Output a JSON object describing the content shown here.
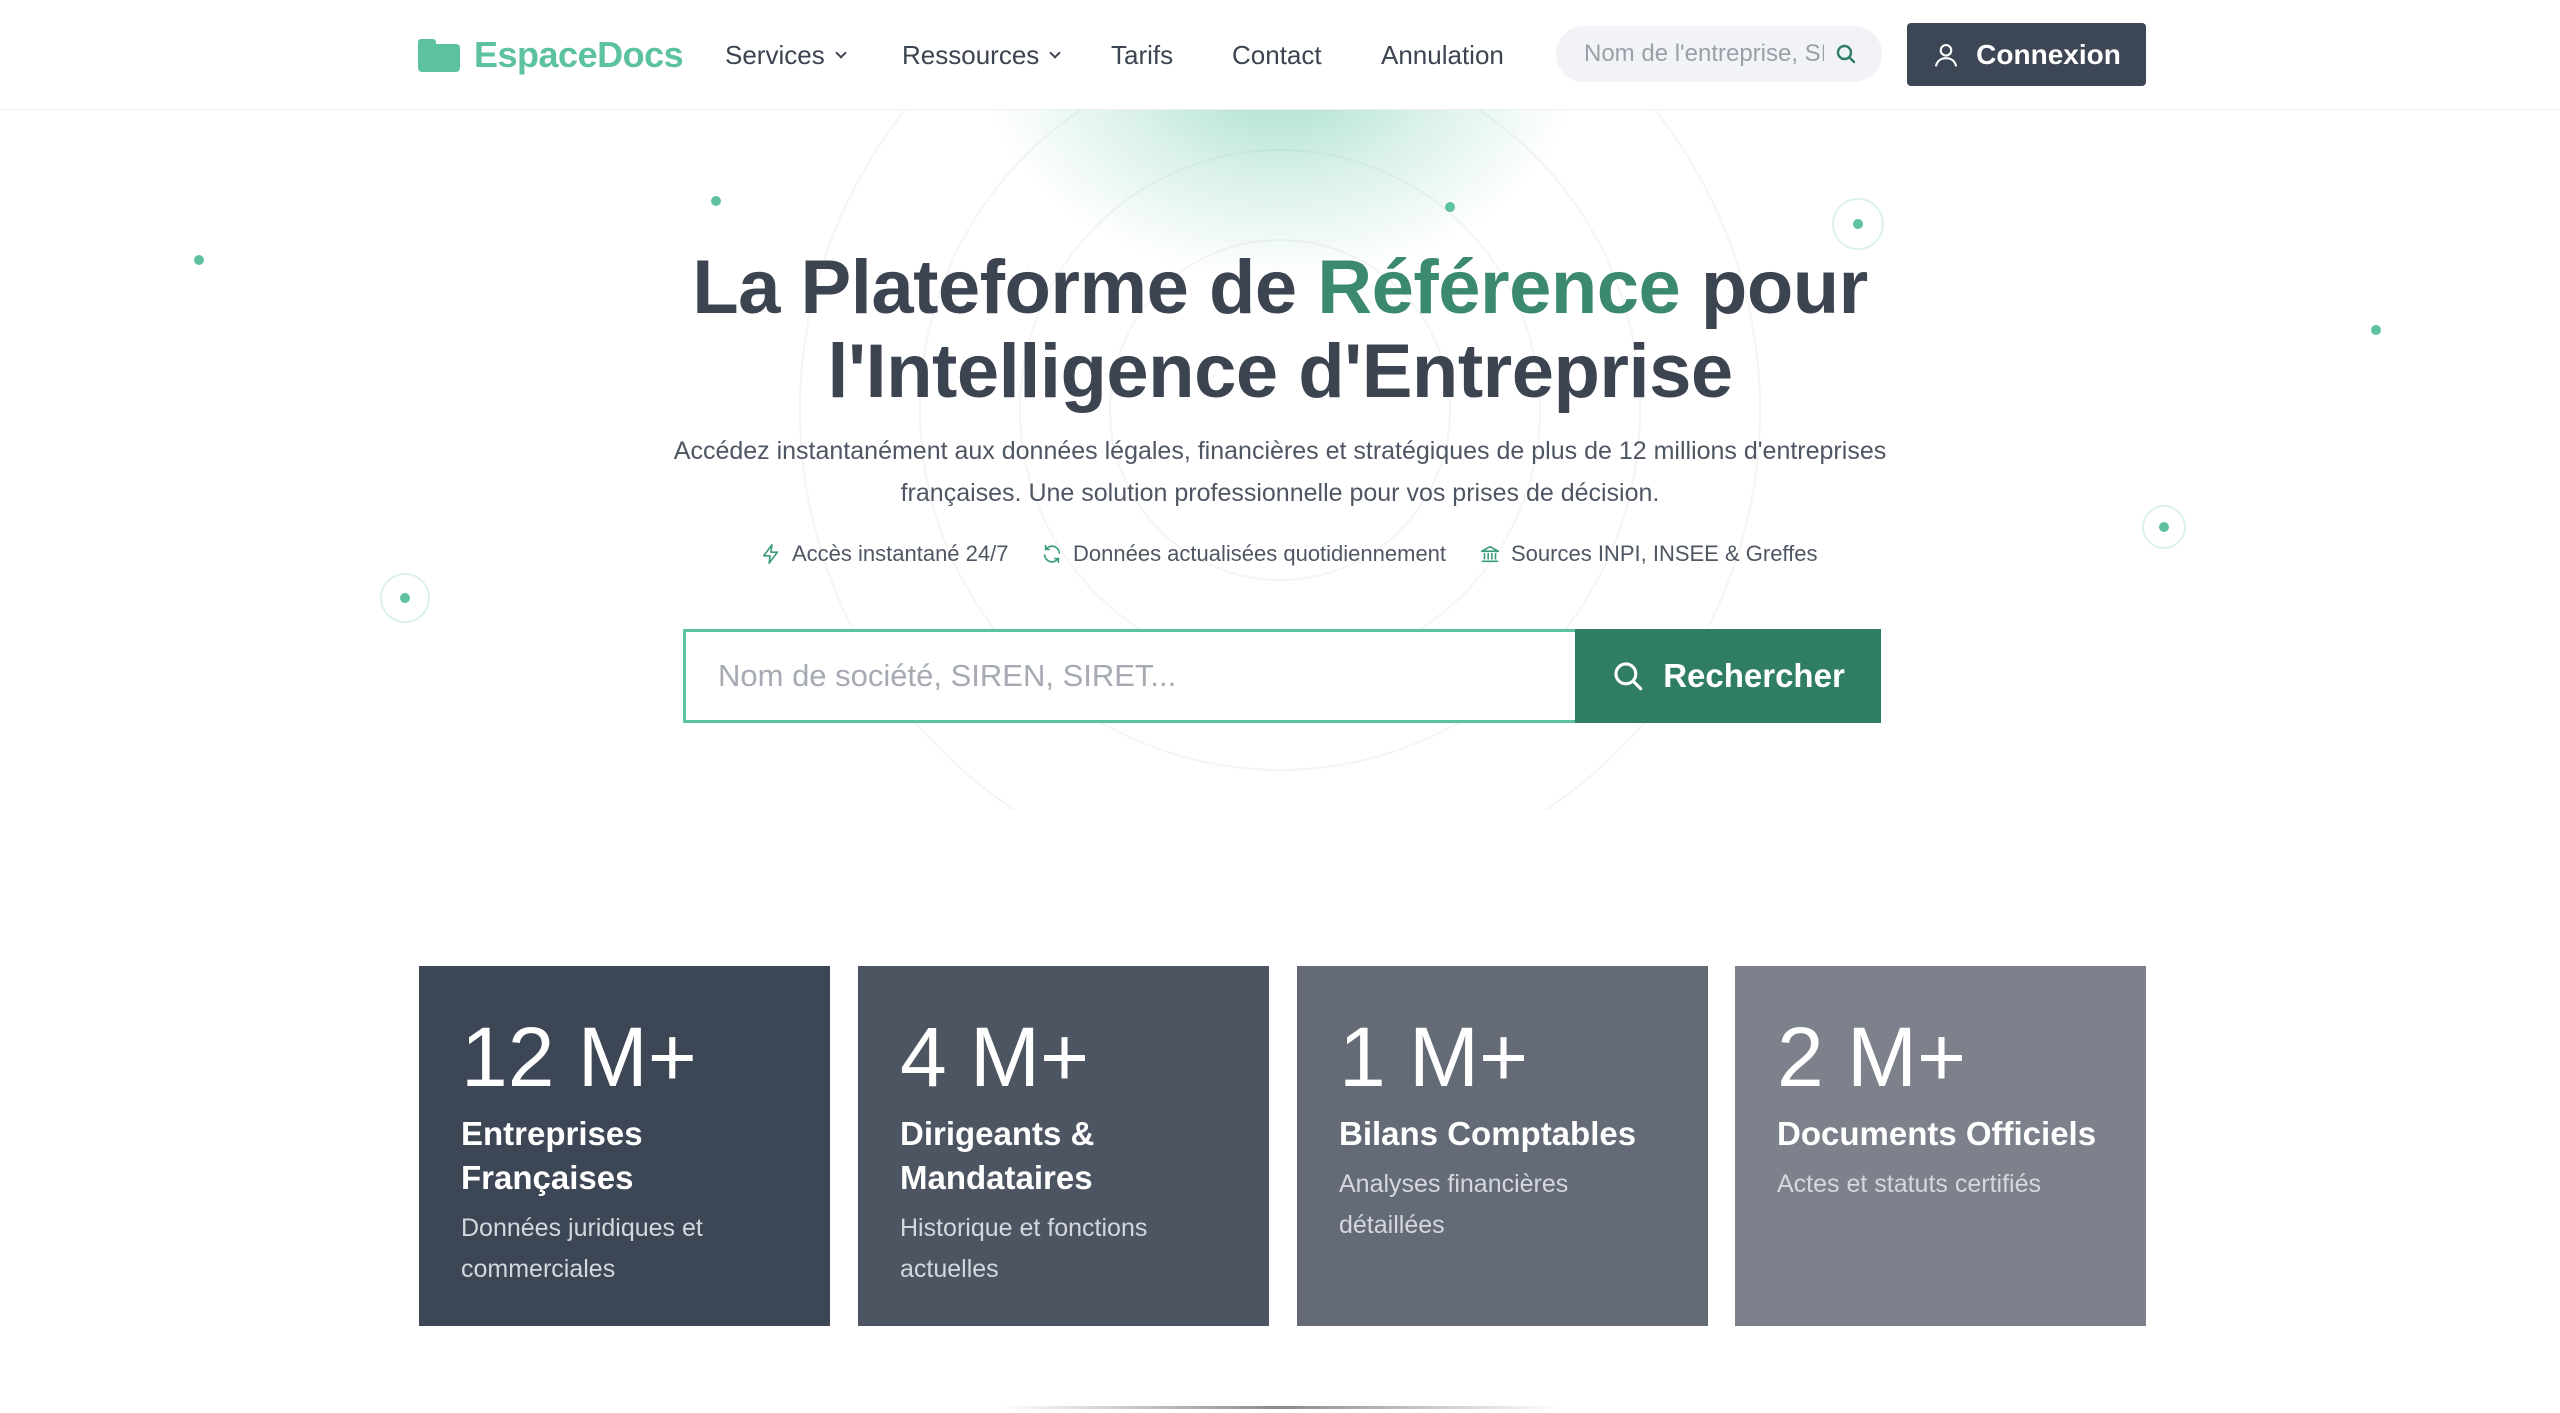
{
  "brand": {
    "name": "EspaceDocs",
    "accent": "#5cc2a0",
    "dark_accent": "#2f7d63"
  },
  "nav": {
    "items": [
      {
        "label": "Services",
        "dropdown": true
      },
      {
        "label": "Ressources",
        "dropdown": true
      },
      {
        "label": "Tarifs",
        "dropdown": false
      },
      {
        "label": "Contact",
        "dropdown": false
      },
      {
        "label": "Annulation",
        "dropdown": false
      }
    ],
    "search_placeholder": "Nom de l'entreprise, SIREN...",
    "search_icon": "search-icon",
    "login_label": "Connexion",
    "login_icon": "user-icon"
  },
  "hero": {
    "title_part1": "La Plateforme de ",
    "title_accent": "Référence",
    "title_part2": " pour",
    "title_line2": "l'Intelligence d'Entreprise",
    "subtitle_line1": "Accédez instantanément aux données légales, financières et stratégiques de plus de 12 millions d'entreprises",
    "subtitle_line2": "françaises. Une solution professionnelle pour vos prises de décision.",
    "features": [
      {
        "icon": "lightning-icon",
        "label": "Accès instantané 24/7"
      },
      {
        "icon": "refresh-icon",
        "label": "Données actualisées quotidiennement"
      },
      {
        "icon": "bank-icon",
        "label": "Sources INPI, INSEE & Greffes"
      }
    ],
    "search_placeholder": "Nom de société, SIREN, SIRET...",
    "search_button": "Rechercher"
  },
  "stats": [
    {
      "value": "12 M+",
      "title": "Entreprises Françaises",
      "description": "Données juridiques et commerciales",
      "color": "#3d4654"
    },
    {
      "value": "4 M+",
      "title": "Dirigeants & Mandataires",
      "description": "Historique et fonctions actuelles",
      "color": "#4d5562"
    },
    {
      "value": "1 M+",
      "title": "Bilans Comptables",
      "description": "Analyses financières détaillées",
      "color": "#646b77"
    },
    {
      "value": "2 M+",
      "title": "Documents Officiels",
      "description": "Actes et statuts certifiés",
      "color": "#7c818c"
    }
  ]
}
